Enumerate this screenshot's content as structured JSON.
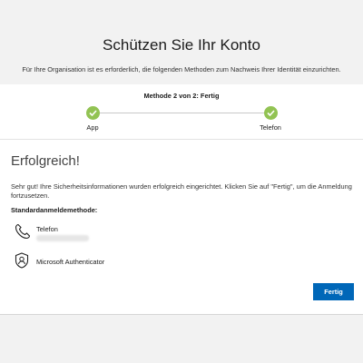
{
  "header": {
    "title": "Schützen Sie Ihr Konto",
    "subtitle": "Für Ihre Organisation ist es erforderlich, die folgenden Methoden zum Nachweis Ihrer Identität einzurichten."
  },
  "progress": {
    "label": "Methode 2 von 2: Fertig",
    "steps": [
      {
        "label": "App",
        "status": "complete"
      },
      {
        "label": "Telefon",
        "status": "complete"
      }
    ],
    "accent_color": "#92c353"
  },
  "result": {
    "title": "Erfolgreich!",
    "text": "Sehr gut! Ihre Sicherheitsinformationen wurden erfolgreich eingerichtet. Klicken Sie auf \"Fertig\", um die Anmeldung fortzusetzen.",
    "default_method_heading": "Standardanmeldemethode:",
    "methods": [
      {
        "label": "Telefon",
        "icon": "phone-icon"
      },
      {
        "label": "Microsoft Authenticator",
        "icon": "authenticator-icon"
      }
    ]
  },
  "actions": {
    "done_label": "Fertig",
    "button_color": "#0067b8"
  }
}
